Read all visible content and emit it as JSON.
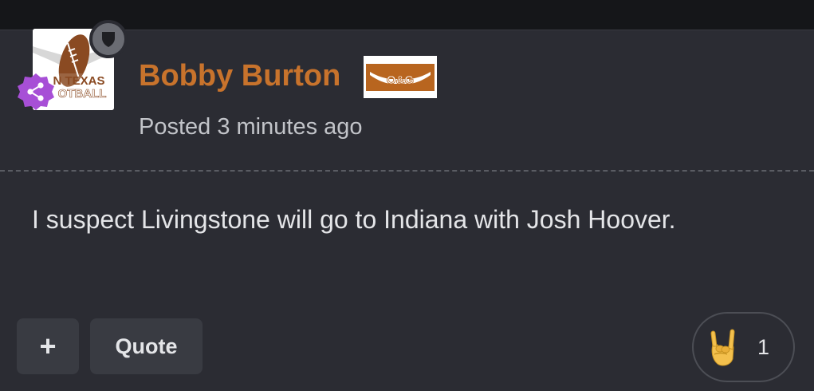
{
  "post": {
    "author": "Bobby Burton",
    "posted": "Posted 3 minutes ago",
    "body": "I suspect Livingstone will go to Indiana with Josh Hoover.",
    "avatar_text_line1": "N TEXAS",
    "avatar_text_line2": "OTBALL",
    "group_badge_text": "O&G"
  },
  "actions": {
    "plus_label": "+",
    "quote_label": "Quote"
  },
  "reaction": {
    "icon": "rock-on-hand-emoji",
    "count": "1"
  },
  "colors": {
    "author": "#c8732c",
    "background": "#2b2c33",
    "button": "#393b42",
    "share_badge": "#a74fd6",
    "mod_badge": "#6a6c73"
  }
}
